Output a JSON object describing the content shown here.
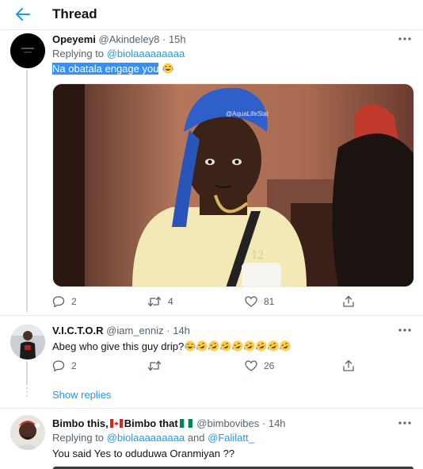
{
  "header": {
    "title": "Thread"
  },
  "tweets": [
    {
      "display_name": "Opeyemi",
      "handle": "@Akindeley8",
      "dot": "·",
      "time": "15h",
      "replying_prefix": "Replying to",
      "replying_to": [
        "@biolaaaaaaaaa"
      ],
      "text_highlighted": "Na obatala engage you",
      "emojis": [
        "face-with-tears-of-joy"
      ],
      "media_watermark": "@AquaLifeStat",
      "stats": {
        "replies": "2",
        "retweets": "4",
        "likes": "81"
      }
    },
    {
      "display_name": "V.I.C.T.O.R",
      "handle": "@iam_enniz",
      "dot": "·",
      "time": "14h",
      "text": "Abeg who give this guy drip?",
      "emojis": [
        "face-with-tears-of-joy",
        "rolling-on-floor-laughing",
        "rolling-on-floor-laughing",
        "rolling-on-floor-laughing",
        "rolling-on-floor-laughing",
        "rolling-on-floor-laughing",
        "rolling-on-floor-laughing",
        "rolling-on-floor-laughing",
        "rolling-on-floor-laughing"
      ],
      "stats": {
        "replies": "2",
        "retweets": "",
        "likes": "26"
      }
    },
    {
      "display_name_part1": "Bimbo this,",
      "display_name_part2": "Bimbo that",
      "flags": [
        "canada-flag",
        "nigeria-flag"
      ],
      "handle": "@bimbovibes",
      "dot": "·",
      "time": "14h",
      "replying_prefix": "Replying to",
      "replying_to": [
        "@biolaaaaaaaaa",
        "@Falilatt_"
      ],
      "replying_joiner": "and",
      "text": "You said Yes to oduduwa Oranmiyan ??"
    }
  ],
  "show_replies": "Show replies",
  "colors": {
    "accent": "#1d9bf0",
    "text": "#0f1419",
    "muted": "#536471",
    "border": "#e6ecf0",
    "highlight": "#3390ff"
  }
}
